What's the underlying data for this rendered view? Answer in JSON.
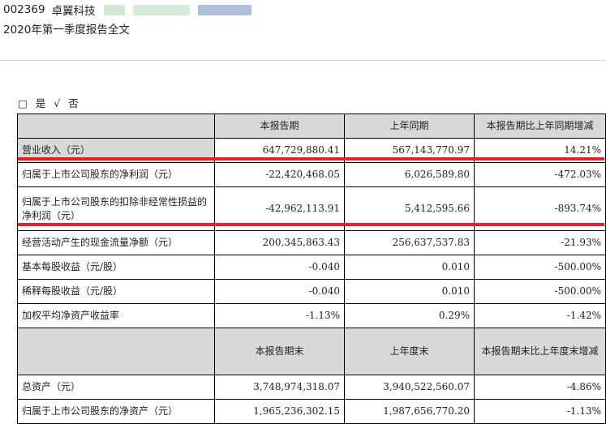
{
  "header": {
    "stock_code": "002369",
    "company": "卓翼科技",
    "doc_title": "2020年第一季度报告全文"
  },
  "choice": {
    "box": "□",
    "yes": "是",
    "check": "√",
    "no": "否"
  },
  "table1": {
    "headers": [
      "",
      "本报告期",
      "上年同期",
      "本报告期比上年同期增减"
    ],
    "rows": [
      {
        "label": "营业收入（元）",
        "current": "647,729,880.41",
        "prior": "567,143,770.97",
        "change": "14.21%"
      },
      {
        "label": "归属于上市公司股东的净利润（元）",
        "current": "-22,420,468.05",
        "prior": "6,026,589.80",
        "change": "-472.03%"
      },
      {
        "label": "归属于上市公司股东的扣除非经常性损益的净利润（元）",
        "current": "-42,962,113.91",
        "prior": "5,412,595.66",
        "change": "-893.74%"
      },
      {
        "label": "经营活动产生的现金流量净额（元）",
        "current": "200,345,863.43",
        "prior": "256,637,537.83",
        "change": "-21.93%"
      },
      {
        "label": "基本每股收益（元/股）",
        "current": "-0.040",
        "prior": "0.010",
        "change": "-500.00%"
      },
      {
        "label": "稀释每股收益（元/股）",
        "current": "-0.040",
        "prior": "0.010",
        "change": "-500.00%"
      },
      {
        "label": "加权平均净资产收益率",
        "current": "-1.13%",
        "prior": "0.29%",
        "change": "-1.42%"
      }
    ]
  },
  "table2": {
    "headers": [
      "",
      "本报告期末",
      "上年度末",
      "本报告期末比上年度末增减"
    ],
    "rows": [
      {
        "label": "总资产（元）",
        "current": "3,748,974,318.07",
        "prior": "3,940,522,560.07",
        "change": "-4.86%"
      },
      {
        "label": "归属于上市公司股东的净资产（元）",
        "current": "1,965,236,302.15",
        "prior": "1,987,656,770.20",
        "change": "-1.13%"
      }
    ]
  },
  "colors": {
    "highlight": "#ee1c24",
    "header_bg": "#d9d9d9"
  }
}
